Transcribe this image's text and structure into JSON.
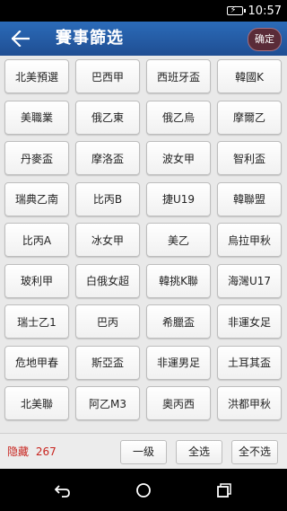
{
  "status_bar": {
    "time": "10:57"
  },
  "header": {
    "title": "賽事篩选",
    "confirm_label": "确定"
  },
  "leagues": [
    "北美預選",
    "巴西甲",
    "西班牙盃",
    "韓國K",
    "美職業",
    "俄乙東",
    "俄乙烏",
    "摩爾乙",
    "丹麥盃",
    "摩洛盃",
    "波女甲",
    "智利盃",
    "瑞典乙南",
    "比丙B",
    "捷U19",
    "韓聯盟",
    "比丙A",
    "冰女甲",
    "美乙",
    "烏拉甲秋",
    "玻利甲",
    "白俄女超",
    "韓挑K聯",
    "海灣U17",
    "瑞士乙1",
    "巴丙",
    "希臘盃",
    "非運女足",
    "危地甲春",
    "斯亞盃",
    "非運男足",
    "土耳其盃",
    "北美聯",
    "阿乙M3",
    "奧丙西",
    "洪都甲秋"
  ],
  "footer": {
    "hidden_label": "隐藏",
    "hidden_count": "267",
    "level_one_label": "一级",
    "select_all_label": "全选",
    "select_none_label": "全不选"
  },
  "colors": {
    "header": "#1f4e93",
    "hidden_text": "#c8251f"
  },
  "icons": {
    "back": "back-arrow-icon",
    "nav": [
      "back-icon",
      "home-icon",
      "recents-icon"
    ]
  }
}
